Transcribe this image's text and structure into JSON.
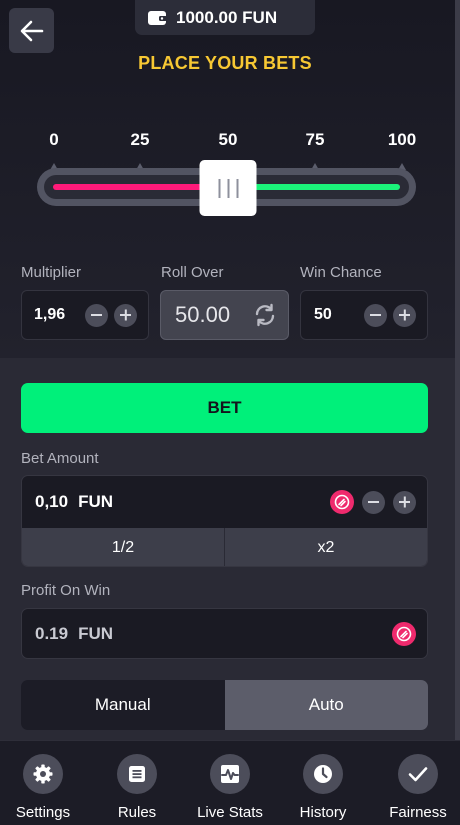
{
  "header": {
    "balance": "1000.00 FUN",
    "title": "PLACE YOUR BETS"
  },
  "slider": {
    "ticks": [
      "0",
      "25",
      "50",
      "75",
      "100"
    ],
    "value_percent": 50,
    "colors": {
      "lose": "#ff1a7a",
      "win": "#1bf37a"
    }
  },
  "fields": {
    "multiplier": {
      "label": "Multiplier",
      "value": "1,96"
    },
    "roll_over": {
      "label": "Roll Over",
      "value": "50.00"
    },
    "win_chance": {
      "label": "Win Chance",
      "value": "50"
    }
  },
  "bet": {
    "button_label": "BET",
    "amount_label": "Bet Amount",
    "amount_value": "0,10",
    "currency": "FUN",
    "half_label": "1/2",
    "double_label": "x2"
  },
  "profit": {
    "label": "Profit On Win",
    "value": "0.19",
    "currency": "FUN"
  },
  "mode": {
    "manual": "Manual",
    "auto": "Auto",
    "selected": "Manual"
  },
  "nav": [
    {
      "label": "Settings",
      "icon": "gear-icon"
    },
    {
      "label": "Rules",
      "icon": "document-icon"
    },
    {
      "label": "Live Stats",
      "icon": "pulse-icon"
    },
    {
      "label": "History",
      "icon": "clock-icon"
    },
    {
      "label": "Fairness",
      "icon": "checkmark-icon"
    }
  ],
  "colors": {
    "accent_title": "#f7c833",
    "bet_button": "#00f07a",
    "coin": "#ef2a6d"
  }
}
